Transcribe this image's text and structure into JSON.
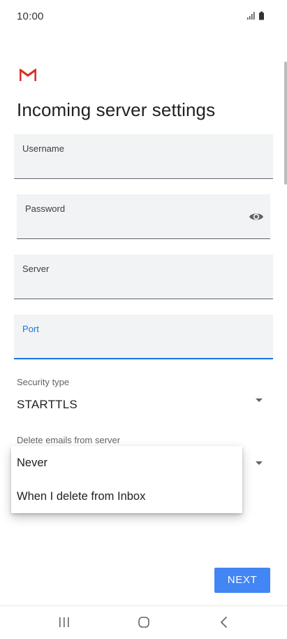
{
  "status_bar": {
    "time": "10:00",
    "icons": [
      "signal-icon",
      "battery-icon"
    ]
  },
  "app": {
    "logo": "gmail-logo-icon",
    "accent_color": "#1a73e8",
    "logo_color": "#d93025"
  },
  "page": {
    "title": "Incoming server settings"
  },
  "form": {
    "username": {
      "label": "Username",
      "value": ""
    },
    "password": {
      "label": "Password",
      "value": "",
      "toggle_icon": "eye-icon"
    },
    "server": {
      "label": "Server",
      "value": ""
    },
    "port": {
      "label": "Port",
      "value": "",
      "focused": true
    },
    "security_type": {
      "label": "Security type",
      "value": "STARTTLS"
    },
    "delete_emails": {
      "label": "Delete emails from server",
      "options": [
        "Never",
        "When I delete from Inbox"
      ]
    }
  },
  "actions": {
    "next_label": "NEXT",
    "next_color": "#4285f4"
  },
  "nav_bar": {
    "buttons": [
      "recent-apps-icon",
      "home-icon",
      "back-icon"
    ]
  }
}
